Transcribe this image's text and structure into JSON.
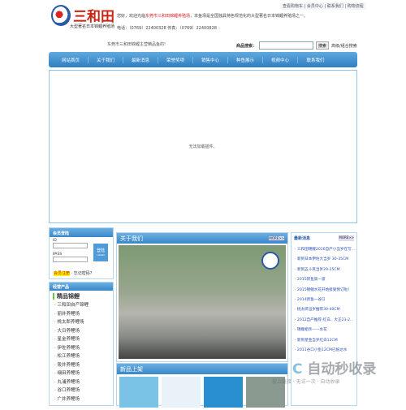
{
  "header": {
    "top_links": "查看购物车 | 会员中心 | 联系我们 | 购物流程",
    "brand": "三和田",
    "brand_sub": "大型著名日本锦鲤养殖场",
    "welcome_pre": "您好，欢迎光临",
    "welcome_red": "东莞市三和田锦鲤养殖场",
    "welcome_post": "，本鱼场是全国独具特色规范化的大型著名日本锦鲤养殖场之一。",
    "tel": "电话：（0769）22400328 传真：（0769）22400828",
    "notice": "东莞市三和田锦鲤主营精品鱼的!",
    "search_label": "商品搜索：",
    "search_value": "",
    "search_button": "搜索",
    "advanced_search": "高级/组合搜索"
  },
  "nav": [
    "网站首页",
    "关于我们",
    "最新消息",
    "荣誉奖项",
    "销售中心",
    "种鱼展示",
    "视频中心",
    "联系我们"
  ],
  "plugin_message": "无法加载插件。",
  "login": {
    "title": "会员登陆",
    "id_label": "ID",
    "pass_label": "PASS",
    "button": "登陆",
    "button_sub": "LOGIN",
    "register": "会员注册",
    "forgot": "· 忘记密码?"
  },
  "products": {
    "title": "经营产品",
    "heading": "精品锦鲤",
    "items": [
      "三和田自产锦鲤",
      "丽井养鲤场",
      "桃太郎养鲤场",
      "大日养鲤场",
      "星金养鲤场",
      "伊佐养鲤场",
      "松江养鲤场",
      "阪井养鲤场",
      "细田养鲤场",
      "丸浦养鲤场",
      "谷口养鲤场",
      "广井养鲤场"
    ]
  },
  "about": {
    "title": "关于我们",
    "more": "MORE>>"
  },
  "new_products": {
    "title": "新品上架"
  },
  "news": {
    "title": "最新消息",
    "more": "MORE>>",
    "items": [
      "三和田锦鲤2016自产小当岁在写...",
      "新到日本伊佐大当岁 30-35CM",
      "新到五十岚当岁29-25CM",
      "2015新鱼第一波",
      "2015锦鲤水花开始接受预订啦！",
      "2014新鱼一谷口",
      "桃太郎当岁推荐30-40CM",
      "2012自产推荐-红白、大正23-2...",
      "锦鲤相亲——水花",
      "新到星金当岁红白12CM",
      "2011谷口小鱼12CM已抵达水"
    ]
  },
  "watermark": {
    "logo": "自动秒收录",
    "tagline": "放上链接 · 无访一次 · 自动收录"
  }
}
